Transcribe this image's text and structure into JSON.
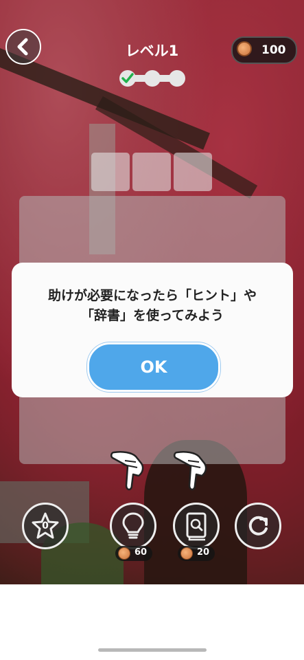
{
  "header": {
    "back_icon": "chevron-left-icon",
    "level_title": "レベル1",
    "progress_steps": 3,
    "progress_completed": 1,
    "coins": "100"
  },
  "answer_tiles": 3,
  "dialog": {
    "line1": "助けが必要になったら「ヒント」や",
    "line2": "「辞書」を使ってみよう",
    "ok_label": "OK"
  },
  "toolbar": {
    "star_count": "0",
    "hint_cost": "60",
    "dictionary_cost": "20",
    "icons": [
      "star-icon",
      "lightbulb-icon",
      "dictionary-icon",
      "shuffle-icon"
    ]
  },
  "colors": {
    "ok_button": "#4fa7ea",
    "check": "#22b14c",
    "coin": "#d9864a"
  }
}
